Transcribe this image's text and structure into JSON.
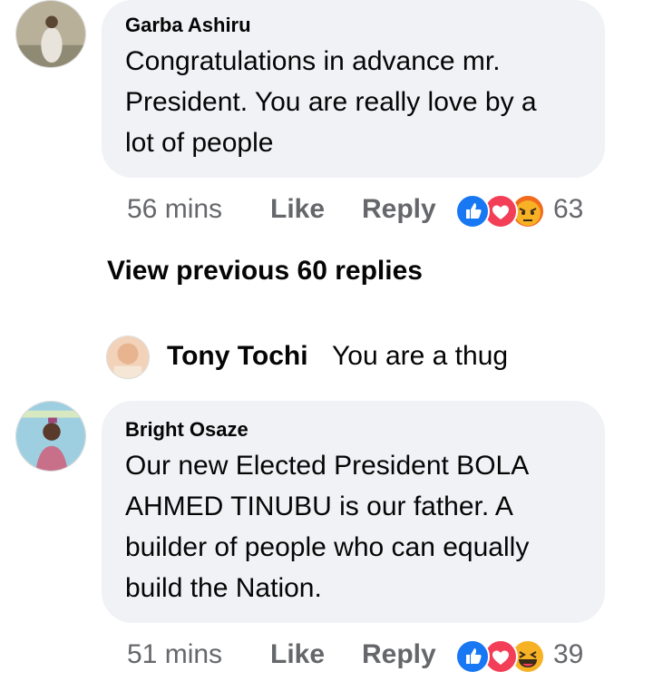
{
  "comments": [
    {
      "author": "Garba Ashiru",
      "lines": [
        "Congratulations in advance mr.",
        "President. You are really love by a",
        "lot of people"
      ],
      "time": "56 mins",
      "like_label": "Like",
      "reply_label": "Reply",
      "reactions": [
        "like-icon",
        "love-icon",
        "angry-icon"
      ],
      "reaction_count": "63"
    },
    {
      "author": "Bright Osaze",
      "lines": [
        "Our new Elected President BOLA",
        "AHMED TINUBU is our father. A",
        "builder of people who can equally",
        "build the Nation."
      ],
      "time": "51 mins",
      "like_label": "Like",
      "reply_label": "Reply",
      "reactions": [
        "like-icon",
        "love-icon",
        "haha-icon"
      ],
      "reaction_count": "39"
    }
  ],
  "view_previous": "View previous 60 replies",
  "reply_preview": {
    "author": "Tony Tochi",
    "text": "You are a thug"
  },
  "colors": {
    "bubble": "#f0f2f5",
    "meta_text": "#65676b",
    "like_blue": "#1877f2",
    "love_red": "#f33e58",
    "reaction_yellow": "#f7b125"
  }
}
